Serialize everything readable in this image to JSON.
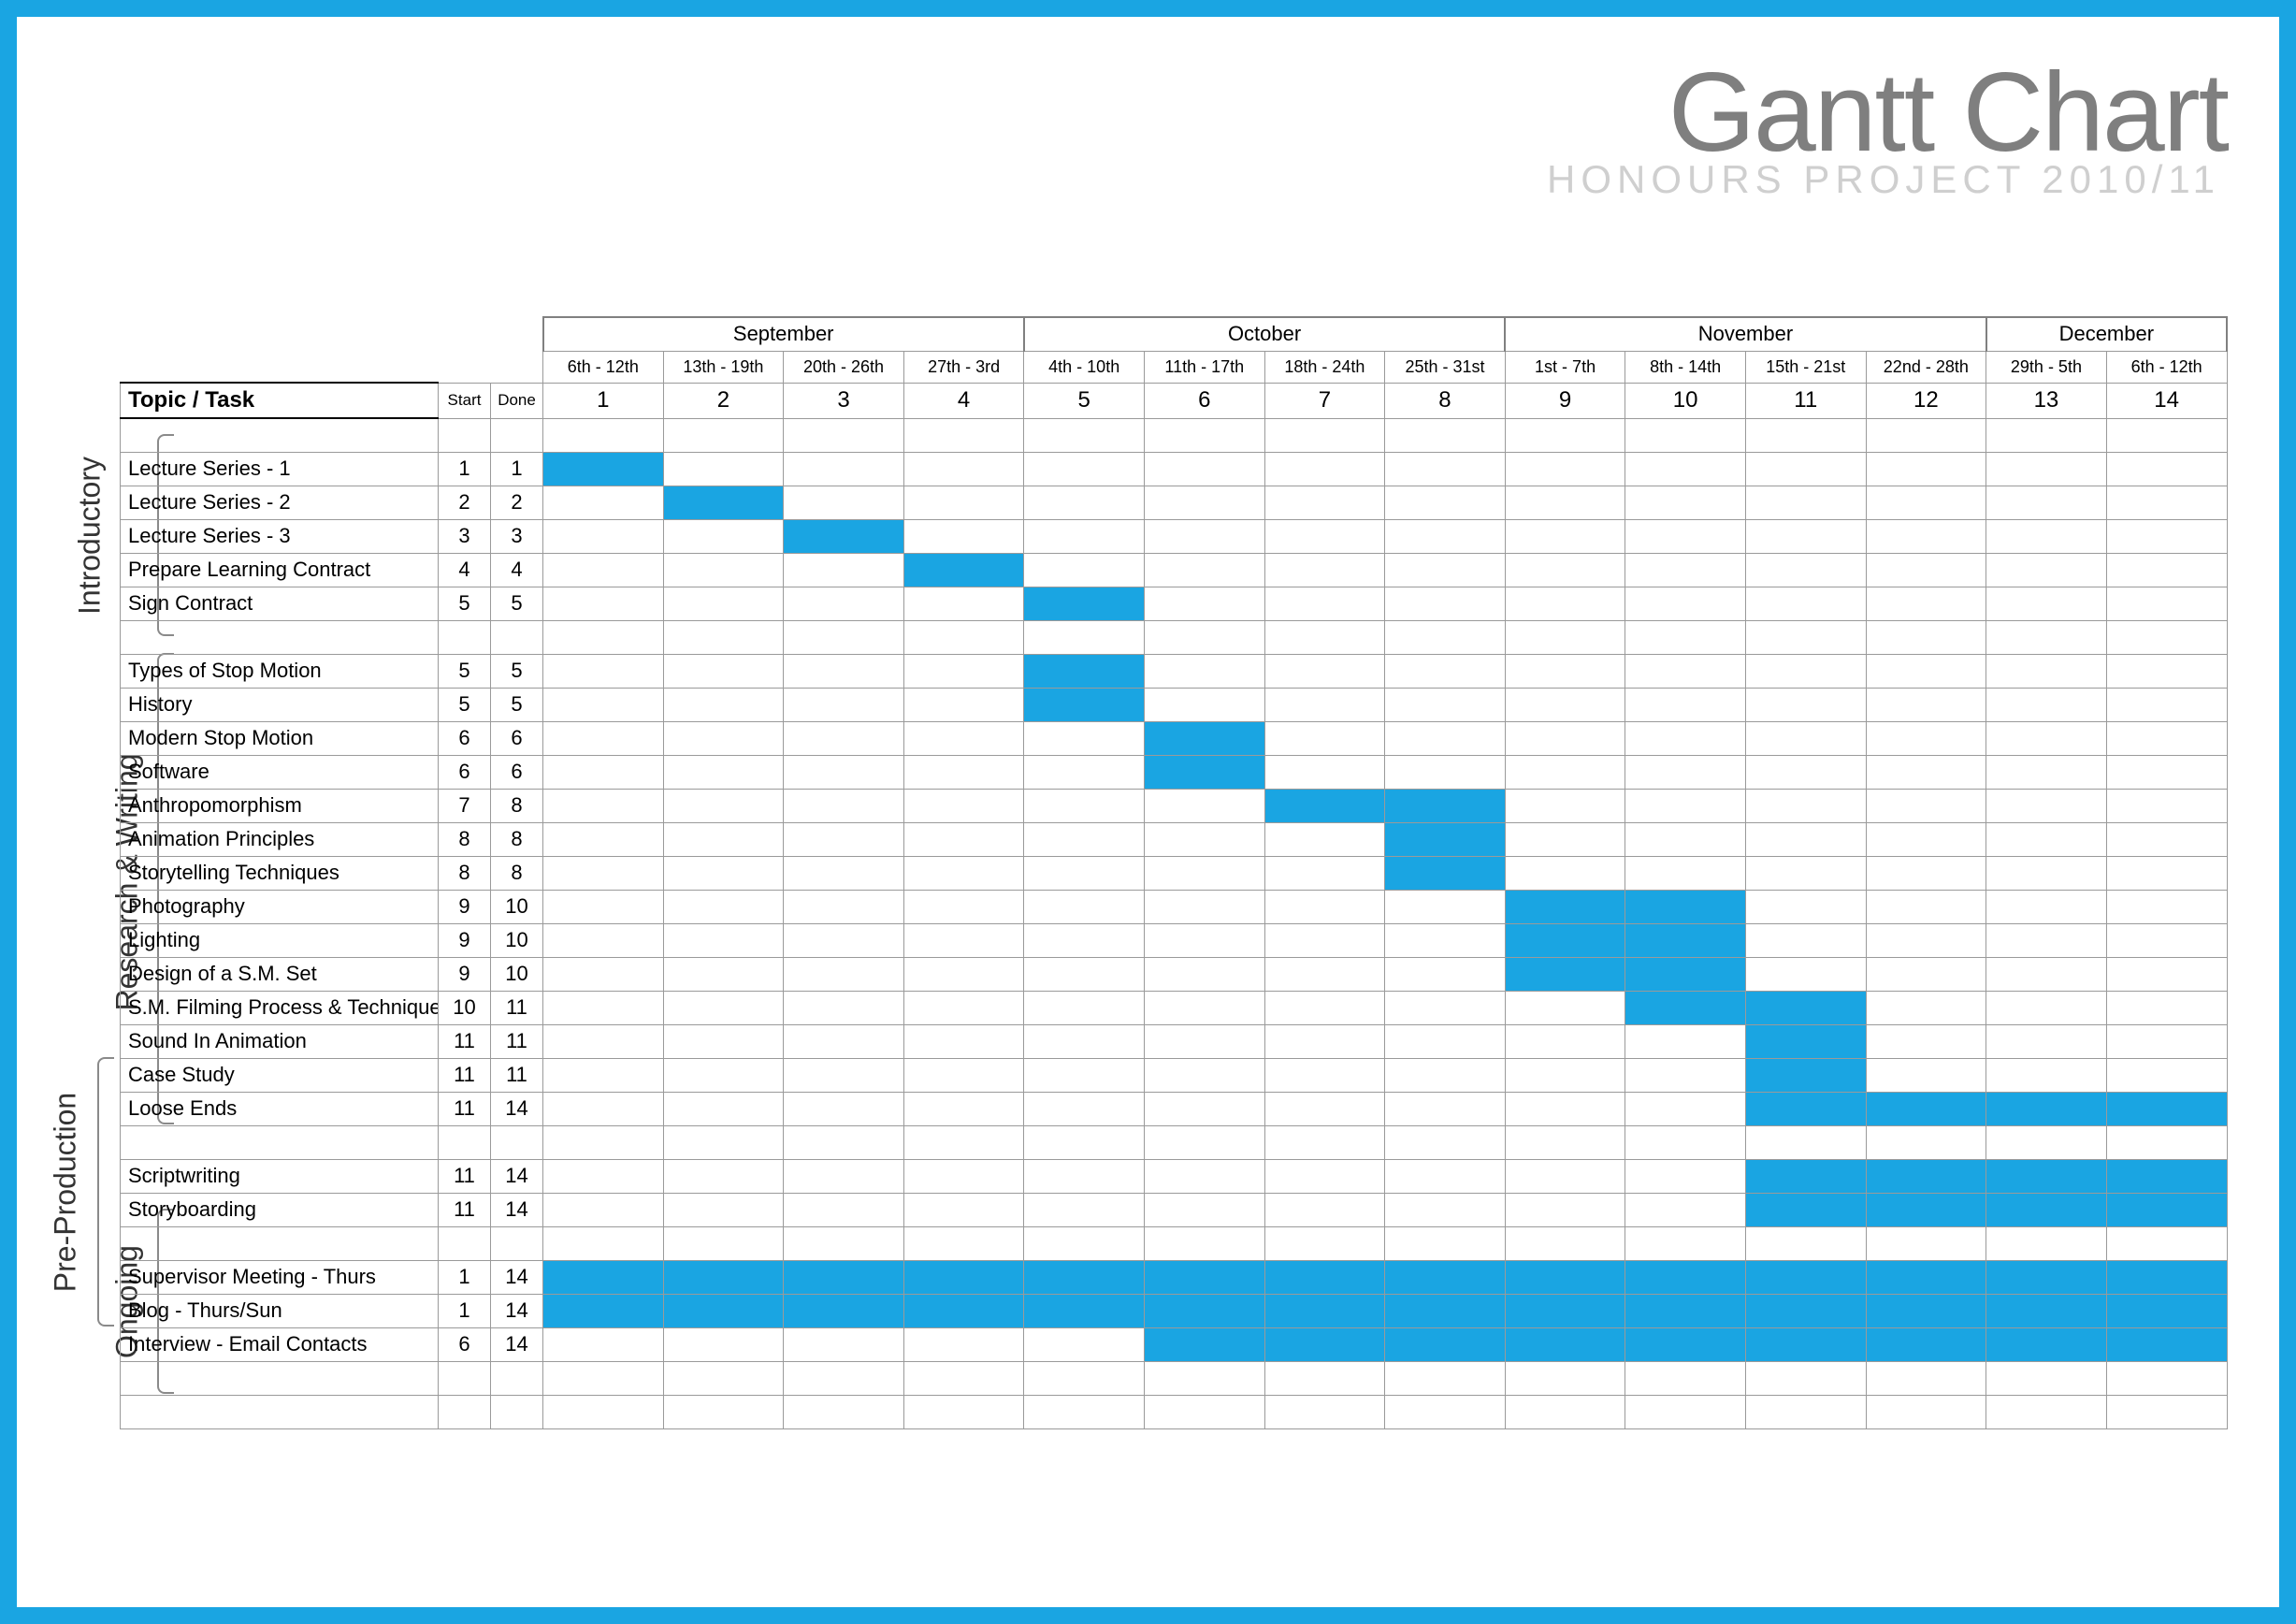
{
  "title": "Gantt Chart",
  "subtitle": "HONOURS PROJECT 2010/11",
  "header": {
    "topic_task": "Topic / Task",
    "start": "Start",
    "done": "Done"
  },
  "months": [
    {
      "name": "September",
      "span": 4
    },
    {
      "name": "October",
      "span": 4
    },
    {
      "name": "November",
      "span": 4
    },
    {
      "name": "December",
      "span": 2
    }
  ],
  "dates": [
    "6th - 12th",
    "13th - 19th",
    "20th - 26th",
    "27th - 3rd",
    "4th - 10th",
    "11th - 17th",
    "18th - 24th",
    "25th - 31st",
    "1st - 7th",
    "8th - 14th",
    "15th - 21st",
    "22nd - 28th",
    "29th - 5th",
    "6th - 12th"
  ],
  "weeks": [
    "1",
    "2",
    "3",
    "4",
    "5",
    "6",
    "7",
    "8",
    "9",
    "10",
    "11",
    "12",
    "13",
    "14"
  ],
  "groups": [
    {
      "label": "Introductory",
      "rows": [
        {
          "spacer": true
        },
        {
          "task": "Lecture Series - 1",
          "start": "1",
          "done": "1",
          "bars": [
            1
          ]
        },
        {
          "task": "Lecture Series - 2",
          "start": "2",
          "done": "2",
          "bars": [
            2
          ]
        },
        {
          "task": "Lecture Series - 3",
          "start": "3",
          "done": "3",
          "bars": [
            3
          ]
        },
        {
          "task": "Prepare Learning Contract",
          "start": "4",
          "done": "4",
          "bars": [
            4
          ]
        },
        {
          "task": "Sign Contract",
          "start": "5",
          "done": "5",
          "bars": [
            5
          ]
        },
        {
          "spacer": true
        }
      ]
    },
    {
      "label": "Research & Writing",
      "rows": [
        {
          "task": "Types of Stop Motion",
          "start": "5",
          "done": "5",
          "bars": [
            5
          ]
        },
        {
          "task": "History",
          "start": "5",
          "done": "5",
          "bars": [
            5
          ]
        },
        {
          "task": "Modern Stop Motion",
          "start": "6",
          "done": "6",
          "bars": [
            6
          ]
        },
        {
          "task": "Software",
          "start": "6",
          "done": "6",
          "bars": [
            6
          ]
        },
        {
          "task": "Anthropomorphism",
          "start": "7",
          "done": "8",
          "bars": [
            7,
            8
          ]
        },
        {
          "task": "Animation Principles",
          "start": "8",
          "done": "8",
          "bars": [
            8
          ]
        },
        {
          "task": "Storytelling Techniques",
          "start": "8",
          "done": "8",
          "bars": [
            8
          ]
        },
        {
          "task": "Photography",
          "start": "9",
          "done": "10",
          "bars": [
            9,
            10
          ]
        },
        {
          "task": "Lighting",
          "start": "9",
          "done": "10",
          "bars": [
            9,
            10
          ]
        },
        {
          "task": "Design of a S.M. Set",
          "start": "9",
          "done": "10",
          "bars": [
            9,
            10
          ]
        },
        {
          "task": "S.M. Filming Process & Techniques",
          "start": "10",
          "done": "11",
          "bars": [
            10,
            11
          ]
        },
        {
          "task": "Sound In Animation",
          "start": "11",
          "done": "11",
          "bars": [
            11
          ]
        },
        {
          "task": "Case Study",
          "start": "11",
          "done": "11",
          "bars": [
            11
          ]
        },
        {
          "task": "Loose Ends",
          "start": "11",
          "done": "14",
          "bars": [
            11,
            12,
            13,
            14
          ]
        },
        {
          "spacer": true
        }
      ]
    },
    {
      "label": "Pre-Production",
      "rows": [
        {
          "task": "Scriptwriting",
          "start": "11",
          "done": "14",
          "bars": [
            11,
            12,
            13,
            14
          ]
        },
        {
          "task": "Storyboarding",
          "start": "11",
          "done": "14",
          "bars": [
            11,
            12,
            13,
            14
          ]
        },
        {
          "spacer": true
        }
      ]
    },
    {
      "label": "Ongoing",
      "rows": [
        {
          "task": "Supervisor Meeting - Thurs",
          "start": "1",
          "done": "14",
          "bars": [
            1,
            2,
            3,
            4,
            5,
            6,
            7,
            8,
            9,
            10,
            11,
            12,
            13,
            14
          ]
        },
        {
          "task": "Blog - Thurs/Sun",
          "start": "1",
          "done": "14",
          "bars": [
            1,
            2,
            3,
            4,
            5,
            6,
            7,
            8,
            9,
            10,
            11,
            12,
            13,
            14
          ]
        },
        {
          "task": "Interview - Email Contacts",
          "start": "6",
          "done": "14",
          "bars": [
            6,
            7,
            8,
            9,
            10,
            11,
            12,
            13,
            14
          ]
        },
        {
          "spacer": true
        },
        {
          "spacer": true
        }
      ]
    }
  ],
  "chart_data": {
    "type": "gantt",
    "title": "Gantt Chart — Honours Project 2010/11",
    "x_unit": "week",
    "x_range": [
      1,
      14
    ],
    "x_week_dates": {
      "1": "6th - 12th Sep",
      "2": "13th - 19th Sep",
      "3": "20th - 26th Sep",
      "4": "27th Sep - 3rd Oct",
      "5": "4th - 10th Oct",
      "6": "11th - 17th Oct",
      "7": "18th - 24th Oct",
      "8": "25th - 31st Oct",
      "9": "1st - 7th Nov",
      "10": "8th - 14th Nov",
      "11": "15th - 21st Nov",
      "12": "22nd - 28th Nov",
      "13": "29th Nov - 5th Dec",
      "14": "6th - 12th Dec"
    },
    "groups": [
      {
        "name": "Introductory",
        "tasks": [
          {
            "name": "Lecture Series - 1",
            "start": 1,
            "end": 1
          },
          {
            "name": "Lecture Series - 2",
            "start": 2,
            "end": 2
          },
          {
            "name": "Lecture Series - 3",
            "start": 3,
            "end": 3
          },
          {
            "name": "Prepare Learning Contract",
            "start": 4,
            "end": 4
          },
          {
            "name": "Sign Contract",
            "start": 5,
            "end": 5
          }
        ]
      },
      {
        "name": "Research & Writing",
        "tasks": [
          {
            "name": "Types of Stop Motion",
            "start": 5,
            "end": 5
          },
          {
            "name": "History",
            "start": 5,
            "end": 5
          },
          {
            "name": "Modern Stop Motion",
            "start": 6,
            "end": 6
          },
          {
            "name": "Software",
            "start": 6,
            "end": 6
          },
          {
            "name": "Anthropomorphism",
            "start": 7,
            "end": 8
          },
          {
            "name": "Animation Principles",
            "start": 8,
            "end": 8
          },
          {
            "name": "Storytelling Techniques",
            "start": 8,
            "end": 8
          },
          {
            "name": "Photography",
            "start": 9,
            "end": 10
          },
          {
            "name": "Lighting",
            "start": 9,
            "end": 10
          },
          {
            "name": "Design of a S.M. Set",
            "start": 9,
            "end": 10
          },
          {
            "name": "S.M. Filming Process & Techniques",
            "start": 10,
            "end": 11
          },
          {
            "name": "Sound In Animation",
            "start": 11,
            "end": 11
          },
          {
            "name": "Case Study",
            "start": 11,
            "end": 11
          },
          {
            "name": "Loose Ends",
            "start": 11,
            "end": 14
          }
        ]
      },
      {
        "name": "Pre-Production",
        "tasks": [
          {
            "name": "Scriptwriting",
            "start": 11,
            "end": 14
          },
          {
            "name": "Storyboarding",
            "start": 11,
            "end": 14
          }
        ]
      },
      {
        "name": "Ongoing",
        "tasks": [
          {
            "name": "Supervisor Meeting - Thurs",
            "start": 1,
            "end": 14
          },
          {
            "name": "Blog - Thurs/Sun",
            "start": 1,
            "end": 14
          },
          {
            "name": "Interview - Email Contacts",
            "start": 6,
            "end": 14
          }
        ]
      }
    ]
  }
}
